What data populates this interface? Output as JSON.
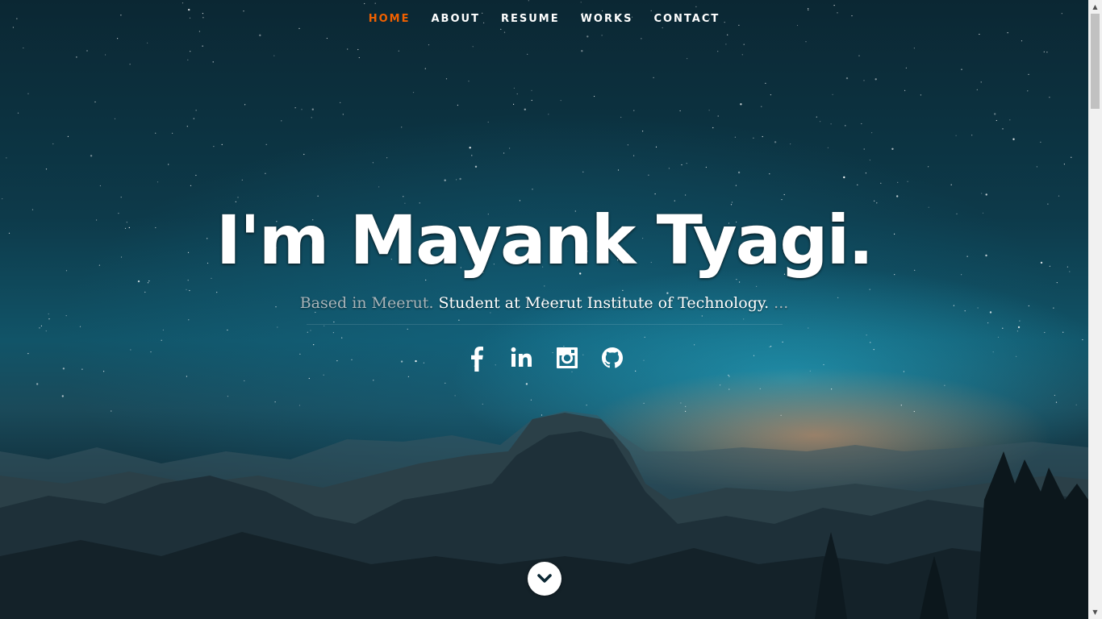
{
  "nav": {
    "items": [
      {
        "label": "HOME",
        "active": true
      },
      {
        "label": "ABOUT",
        "active": false
      },
      {
        "label": "RESUME",
        "active": false
      },
      {
        "label": "WORKS",
        "active": false
      },
      {
        "label": "CONTACT",
        "active": false
      }
    ],
    "active_color": "#f06000"
  },
  "banner": {
    "headline": "I'm Mayank Tyagi.",
    "sub_dim": "Based in Meerut.",
    "sub_bright": "Student at Meerut Institute of Technology.",
    "sub_trail": "..."
  },
  "social": [
    "facebook-icon",
    "linkedin-icon",
    "instagram-icon",
    "github-icon"
  ],
  "scroll_button_icon": "chevron-down-icon"
}
